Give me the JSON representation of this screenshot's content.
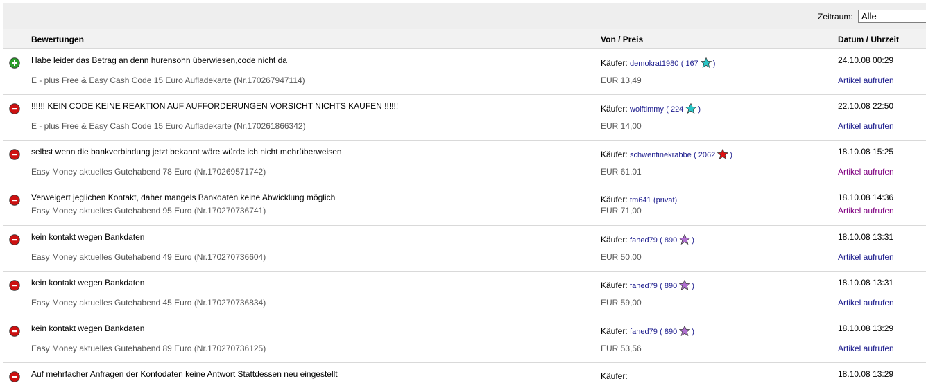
{
  "filter": {
    "label": "Zeitraum:",
    "value": "Alle"
  },
  "columns": {
    "comment": "Bewertungen",
    "from": "Von / Preis",
    "date": "Datum / Uhrzeit"
  },
  "colors": {
    "positive": "#2a9d2a",
    "negative": "#cc1111",
    "link": "#1a1a8c",
    "visited": "#800080"
  },
  "rows": [
    {
      "type": "positive",
      "comment": "Habe leider das Betrag an denn hurensohn überwiesen,code nicht da",
      "item": "E - plus Free & Easy Cash Code 15 Euro Aufladekarte (Nr.170267947114)",
      "buyer_label": "Käufer:",
      "buyer": "demokrat1980",
      "score": "( 167",
      "score_close": ")",
      "star": "turquoise-star",
      "star_color": "#29c6c6",
      "price": "EUR 13,49",
      "date": "24.10.08 00:29",
      "link": "Artikel aufrufen",
      "visited": false
    },
    {
      "type": "negative",
      "comment": "!!!!!! KEIN CODE KEINE REAKTION AUF AUFFORDERUNGEN VORSICHT NICHTS KAUFEN !!!!!!",
      "item": "E - plus Free & Easy Cash Code 15 Euro Aufladekarte (Nr.170261866342)",
      "buyer_label": "Käufer:",
      "buyer": "wolftimmy",
      "score": "( 224",
      "score_close": ")",
      "star": "turquoise-star",
      "star_color": "#29c6c6",
      "price": "EUR 14,00",
      "date": "22.10.08 22:50",
      "link": "Artikel aufrufen",
      "visited": false
    },
    {
      "type": "negative",
      "comment": "selbst wenn die bankverbindung jetzt bekannt wäre würde ich nicht mehrüberweisen",
      "item": "Easy Money aktuelles Gutehabend 78 Euro (Nr.170269571742)",
      "buyer_label": "Käufer:",
      "buyer": "schwentinekrabbe",
      "score": "( 2062",
      "score_close": ")",
      "star": "red-star",
      "star_color": "#e01010",
      "price": "EUR 61,01",
      "date": "18.10.08 15:25",
      "link": "Artikel aufrufen",
      "visited": true
    },
    {
      "type": "negative",
      "comment": "Verweigert jeglichen Kontakt, daher mangels Bankdaten keine Abwicklung möglich",
      "item": "Easy Money aktuelles Gutehabend 95 Euro (Nr.170270736741)",
      "buyer_label": "Käufer:",
      "buyer": "tm641",
      "score": "(privat)",
      "score_close": "",
      "star": "",
      "star_color": "",
      "price": "EUR 71,00",
      "date": "18.10.08 14:36",
      "link": "Artikel aufrufen",
      "visited": true
    },
    {
      "type": "negative",
      "comment": "kein kontakt wegen Bankdaten",
      "item": "Easy Money aktuelles Gutehabend 49 Euro (Nr.170270736604)",
      "buyer_label": "Käufer:",
      "buyer": "fahed79",
      "score": "( 890",
      "score_close": ")",
      "star": "purple-star",
      "star_color": "#b070d0",
      "price": "EUR 50,00",
      "date": "18.10.08 13:31",
      "link": "Artikel aufrufen",
      "visited": false
    },
    {
      "type": "negative",
      "comment": "kein kontakt wegen Bankdaten",
      "item": "Easy Money aktuelles Gutehabend 45 Euro (Nr.170270736834)",
      "buyer_label": "Käufer:",
      "buyer": "fahed79",
      "score": "( 890",
      "score_close": ")",
      "star": "purple-star",
      "star_color": "#b070d0",
      "price": "EUR 59,00",
      "date": "18.10.08 13:31",
      "link": "Artikel aufrufen",
      "visited": false
    },
    {
      "type": "negative",
      "comment": "kein kontakt wegen Bankdaten",
      "item": "Easy Money aktuelles Gutehabend 89 Euro (Nr.170270736125)",
      "buyer_label": "Käufer:",
      "buyer": "fahed79",
      "score": "( 890",
      "score_close": ")",
      "star": "purple-star",
      "star_color": "#b070d0",
      "price": "EUR 53,56",
      "date": "18.10.08 13:29",
      "link": "Artikel aufrufen",
      "visited": false
    },
    {
      "type": "negative",
      "comment": "Auf mehrfacher Anfragen der Kontodaten keine Antwort Stattdessen neu eingestellt",
      "item": "",
      "buyer_label": "Käufer:",
      "buyer": "",
      "score": "",
      "score_close": "",
      "star": "",
      "star_color": "",
      "price": "",
      "date": "18.10.08 13:29",
      "link": "",
      "visited": false
    }
  ]
}
